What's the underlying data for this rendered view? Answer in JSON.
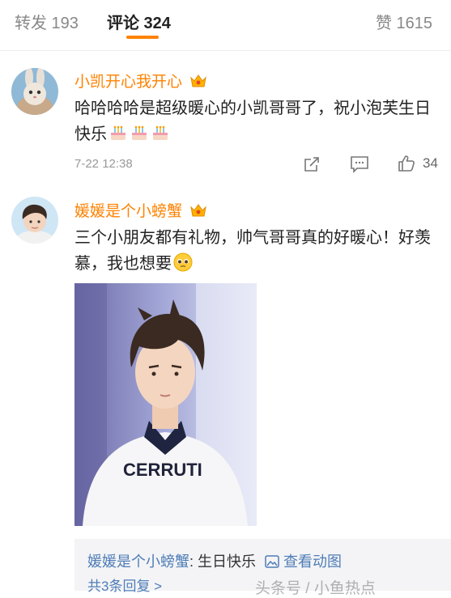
{
  "tabs": {
    "reposts_label": "转发 193",
    "comments_label": "评论 324",
    "likes_label": "赞 1615"
  },
  "comments": [
    {
      "author": "小凯开心我开心",
      "text": "哈哈哈哈是超级暖心的小凯哥哥了，祝小泡芙生日快乐",
      "time": "7-22 12:38",
      "like_count": "34",
      "avatar_icon": "bunny-avatar",
      "emoji_icon": "birthday-cake-icon"
    },
    {
      "author": "媛媛是个小螃蟹",
      "text": "三个小朋友都有礼物，帅气哥哥真的好暖心！好羡慕，我也想要",
      "avatar_icon": "boy-avatar",
      "emoji_icon": "pleading-face-icon",
      "photo_shirt_text": "CERRUTI",
      "reply": {
        "name": "媛媛是个小螃蟹",
        "text": ": 生日快乐",
        "view_gif": "查看动图",
        "more": "共3条回复 >"
      }
    }
  ],
  "watermark": "头条号 / 小鱼热点",
  "colors": {
    "accent": "#ff8200",
    "link": "#4e7db7"
  }
}
